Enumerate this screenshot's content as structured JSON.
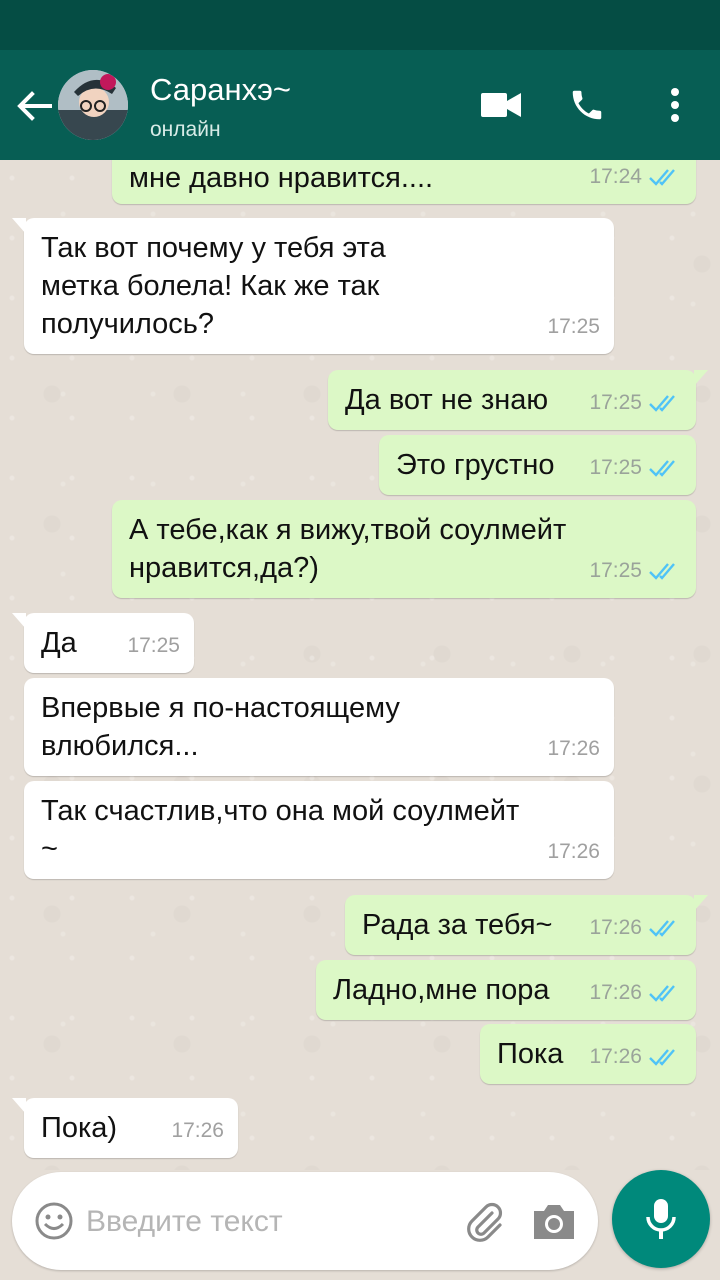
{
  "header": {
    "contact_name": "Саранхэ~",
    "status": "онлайн",
    "icons": {
      "back": "arrow-left-icon",
      "video": "video-camera-icon",
      "call": "phone-icon",
      "more": "more-vertical-icon"
    }
  },
  "messages": [
    {
      "dir": "out",
      "text": "мне давно нравится....",
      "time": "17:24",
      "read": true
    },
    {
      "dir": "in",
      "text": "Так вот почему у тебя эта\nметка болела! Как же так\nполучилось?",
      "time": "17:25"
    },
    {
      "dir": "out",
      "text": "Да вот не знаю",
      "time": "17:25",
      "read": true
    },
    {
      "dir": "out",
      "text": "Это грустно",
      "time": "17:25",
      "read": true
    },
    {
      "dir": "out",
      "text": "А тебе,как я вижу,твой соулмейт\nнравится,да?)",
      "time": "17:25",
      "read": true
    },
    {
      "dir": "in",
      "text": "Да",
      "time": "17:25"
    },
    {
      "dir": "in",
      "text": "Впервые я по-настоящему\nвлюбился...",
      "time": "17:26"
    },
    {
      "dir": "in",
      "text": "Так счастлив,что она мой соулмейт\n~",
      "time": "17:26"
    },
    {
      "dir": "out",
      "text": "Рада за тебя~",
      "time": "17:26",
      "read": true
    },
    {
      "dir": "out",
      "text": "Ладно,мне пора",
      "time": "17:26",
      "read": true
    },
    {
      "dir": "out",
      "text": "Пока",
      "time": "17:26",
      "read": true
    },
    {
      "dir": "in",
      "text": "Пока)",
      "time": "17:26"
    }
  ],
  "composer": {
    "placeholder": "Введите текст",
    "value": ""
  },
  "colors": {
    "statusbar": "#054d44",
    "appbar": "#075e54",
    "outgoing_bubble": "#dcf8c6",
    "incoming_bubble": "#ffffff",
    "read_ticks": "#4fc3f7",
    "mic_button": "#00897b"
  }
}
